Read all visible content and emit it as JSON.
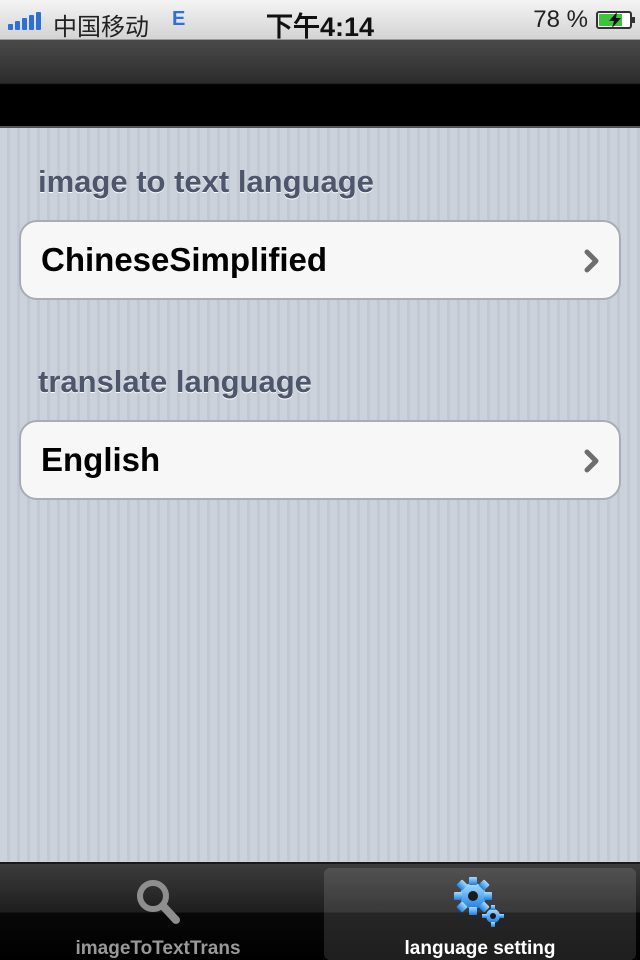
{
  "status_bar": {
    "carrier": "中国移动",
    "network": "E",
    "time": "下午4:14",
    "battery_percent": "78 %",
    "battery_level": 0.78,
    "signal_bars": 5
  },
  "sections": [
    {
      "header": "image to text language",
      "value": "ChineseSimplified"
    },
    {
      "header": "translate language",
      "value": "English"
    }
  ],
  "tab_bar": {
    "tabs": [
      {
        "label": "imageToTextTrans",
        "icon": "search-icon",
        "active": false
      },
      {
        "label": "language setting",
        "icon": "gear-icon",
        "active": true
      }
    ]
  },
  "colors": {
    "section_header": "#4d566b",
    "network_indicator": "#2f6fd6",
    "battery_fill": "#3cc43a"
  }
}
